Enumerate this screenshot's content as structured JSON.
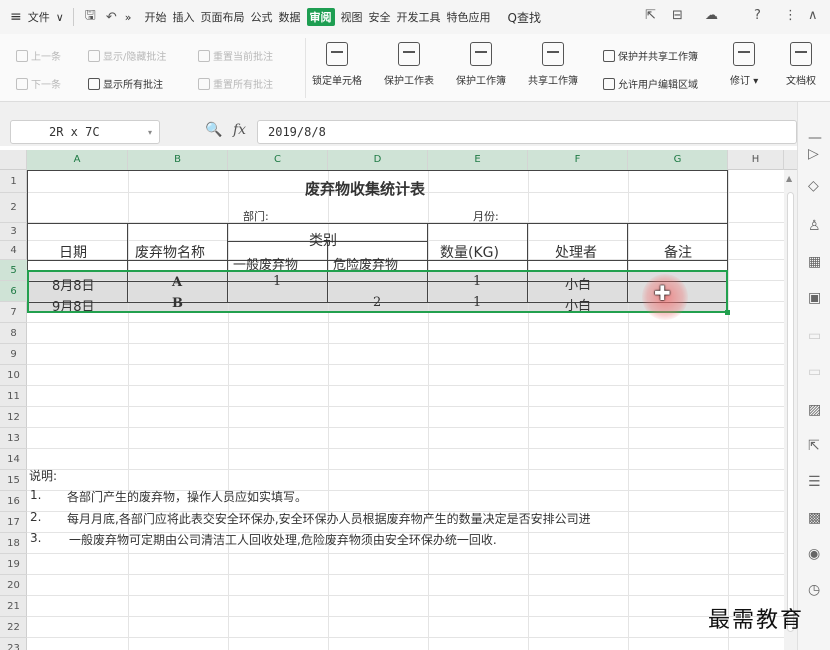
{
  "menubar": {
    "hamburger": "≡",
    "file": "文件",
    "file_caret": "∨",
    "more": "»",
    "tabs": [
      "开始",
      "插入",
      "页面布局",
      "公式",
      "数据",
      "审阅",
      "视图",
      "安全",
      "开发工具",
      "特色应用"
    ],
    "active_tab": "审阅",
    "search": "Q查找",
    "help": "?",
    "kebab": "⋮",
    "collapse": "∧"
  },
  "ribbon": {
    "prev_comment": "上一条",
    "next_comment": "下一条",
    "show_hide_comment": "显示/隐藏批注",
    "show_all_comments": "显示所有批注",
    "reset_current_comment": "重置当前批注",
    "reset_all_comments": "重置所有批注",
    "lock_cell": "锁定单元格",
    "protect_sheet": "保护工作表",
    "protect_book": "保护工作簿",
    "share_book": "共享工作簿",
    "protect_share_book": "保护并共享工作簿",
    "allow_edit_range": "允许用户编辑区域",
    "track_changes": "修订",
    "track_caret": "▾",
    "doc_rights": "文档权"
  },
  "formula_bar": {
    "name_box": "2R x 7C",
    "fx": "fx",
    "content": "2019/8/8"
  },
  "columns": [
    "A",
    "B",
    "C",
    "D",
    "E",
    "F",
    "G",
    "H"
  ],
  "rows": [
    "1",
    "2",
    "3",
    "4",
    "5",
    "6",
    "7",
    "8",
    "9",
    "10",
    "11",
    "12",
    "13",
    "14",
    "15",
    "16",
    "17",
    "18",
    "19",
    "20",
    "21",
    "22",
    "23"
  ],
  "sheet": {
    "title": "废弃物收集统计表",
    "dept_label": "部门:",
    "month_label": "月份:",
    "headers": {
      "date": "日期",
      "waste_name": "废弃物名称",
      "category": "类别",
      "general": "一般废弃物",
      "hazardous": "危险废弃物",
      "quantity": "数量(KG)",
      "handler": "处理者",
      "remark": "备注"
    },
    "records": [
      {
        "date": "8月8日",
        "name": "A",
        "general": "1",
        "hazardous": "",
        "quantity": "1",
        "handler": "小白"
      },
      {
        "date": "9月8日",
        "name": "B",
        "general": "",
        "hazardous": "2",
        "quantity": "1",
        "handler": "小白"
      }
    ],
    "notes_title": "说明:",
    "notes": [
      {
        "num": "1.",
        "text": "各部门产生的废弃物，操作人员应如实填写。"
      },
      {
        "num": "2.",
        "text": "每月月底,各部门应将此表交安全环保办,安全环保办人员根据废弃物产生的数量决定是否安排公司进"
      },
      {
        "num": "3.",
        "text": "一般废弃物可定期由公司清洁工人回收处理,危险废弃物须由安全环保办统一回收."
      }
    ]
  },
  "watermark": "最需教育",
  "colors": {
    "accent": "#1e9e52",
    "selection_border": "#22a04e"
  }
}
